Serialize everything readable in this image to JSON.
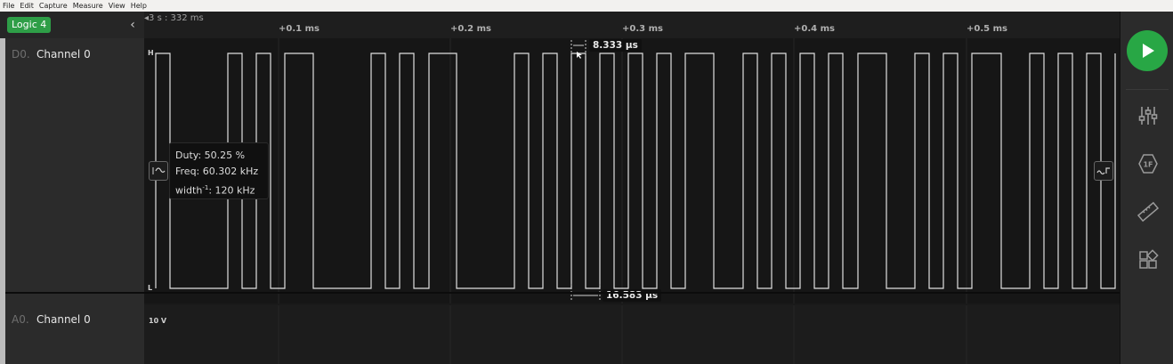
{
  "menu": [
    "File",
    "Edit",
    "Capture",
    "Measure",
    "View",
    "Help"
  ],
  "device": {
    "name": "Logic 4"
  },
  "timeline": {
    "origin": "3 s : 332 ms",
    "ticks": [
      "+0.1 ms",
      "+0.2 ms",
      "+0.3 ms",
      "+0.4 ms",
      "+0.5 ms"
    ]
  },
  "channels": {
    "digital": {
      "id": "D0.",
      "name": "Channel 0",
      "high_label": "H",
      "low_label": "L"
    },
    "analog": {
      "id": "A0.",
      "name": "Channel 0",
      "scale_label": "10 V"
    }
  },
  "tooltip": {
    "duty": "Duty: 50.25 %",
    "freq": "Freq: 60.302 kHz",
    "width_prefix": "width",
    "width_sup": "-1",
    "width_suffix": ": 120 kHz"
  },
  "measurements": {
    "top": "8.333 µs",
    "bottom": "16.583 µs"
  },
  "colors": {
    "accent": "#28a745",
    "waveform": "#e0e0e0",
    "background": "#161616"
  },
  "icons": {
    "collapse": "chevron-left-icon",
    "left_edge": "falling-edge-icon",
    "right_edge": "rising-edge-icon",
    "play": "play-icon",
    "settings": "sliders-icon",
    "analyzers": "hex-1f-icon",
    "measure": "ruler-icon",
    "extensions": "squares-icon"
  }
}
